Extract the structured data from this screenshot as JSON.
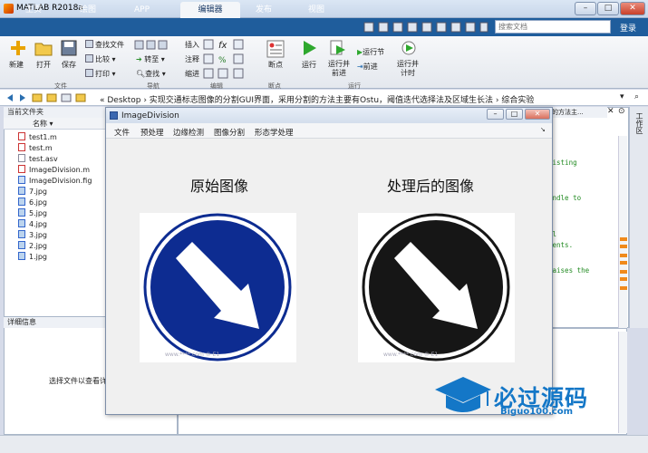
{
  "window": {
    "title": "MATLAB R2018a",
    "min": "–",
    "max": "□",
    "close": "✕"
  },
  "tabs": [
    "主页",
    "绘图",
    "APP",
    "编辑器",
    "发布",
    "视图"
  ],
  "search": {
    "placeholder": "搜索文档"
  },
  "login": "登录",
  "ribbon": {
    "new": "新建",
    "open": "打开",
    "save": "保存",
    "find_file": "查找文件",
    "compare": "比较",
    "print": "打印",
    "insert": "插入",
    "comment": "注释",
    "indent": "缩进",
    "goto": "转至",
    "find": "查找",
    "breakpoint": "断点",
    "run": "运行",
    "run_advance": "运行并\n前进",
    "run_section": "运行节",
    "advance": "前进",
    "run_time": "运行并\n计时",
    "sections": {
      "file": "文件",
      "nav": "导航",
      "edit": "编辑",
      "bp": "断点",
      "run": "运行"
    }
  },
  "address": {
    "path": "«  Desktop  ›  实现交通标志图像的分割GUI界面，采用分割的方法主要有Ostu，阈值迭代选择法及区域生长法  ›  综合实验"
  },
  "current_folder": {
    "header": "当前文件夹",
    "name_col": "名称 ▾",
    "files": [
      "test1.m",
      "test.m",
      "test.asv",
      "ImageDivision.m",
      "ImageDivision.fig",
      "7.jpg",
      "6.jpg",
      "5.jpg",
      "4.jpg",
      "3.jpg",
      "2.jpg",
      "1.jpg"
    ]
  },
  "details": {
    "header": "详细信息",
    "text": "选择文件以查看详"
  },
  "editor": {
    "title": "割的方法主...",
    "code": [
      "xisting",
      "andle to",
      "al",
      "ments.",
      "raises the",
      "e",
      "n"
    ]
  },
  "sidedock": {
    "label": "工作区"
  },
  "figure": {
    "title": "ImageDivision",
    "menus": [
      "文件",
      "预处理",
      "边缘检测",
      "图像分割",
      "形态学处理"
    ],
    "left_title": "原始图像",
    "right_title": "处理后的图像",
    "left_watermark": "www.****.com © E1",
    "right_watermark": "www.****.com © E1"
  },
  "watermark": {
    "brand": "必过源码",
    "url": "Biguo100.com"
  },
  "colors": {
    "sign_blue": "#0d2c91",
    "sign_black": "#161616",
    "tab_blue": "#1f5d9c",
    "brand_blue": "#1477c7"
  }
}
